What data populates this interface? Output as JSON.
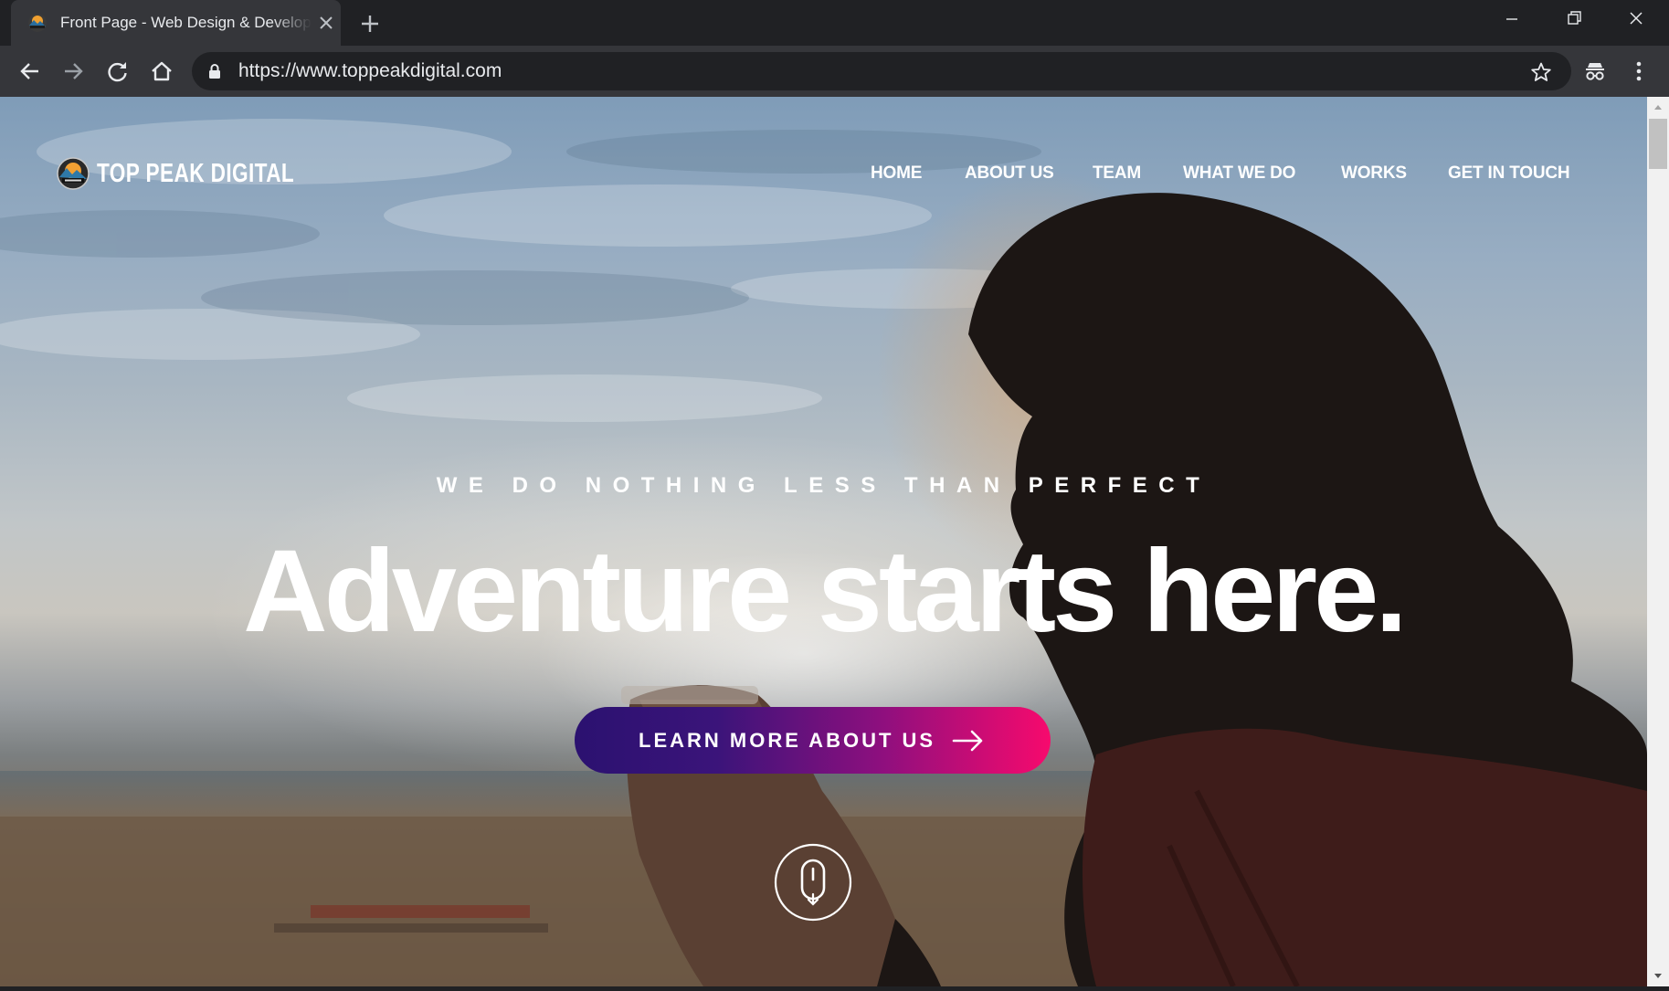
{
  "browser": {
    "tab_title": "Front Page - Web Design & Development",
    "url": "https://www.toppeakdigital.com"
  },
  "site": {
    "brand_name": "TOP PEAK DIGITAL",
    "nav": [
      "HOME",
      "ABOUT US",
      "TEAM",
      "WHAT WE DO",
      "WORKS",
      "GET IN TOUCH"
    ],
    "tagline": "WE DO NOTHING LESS THAN PERFECT",
    "headline": "Adventure starts here.",
    "cta_label": "LEARN MORE ABOUT US"
  },
  "colors": {
    "cta_gradient_start": "#2b1170",
    "cta_gradient_end": "#f70a6d",
    "chrome_dark": "#202124",
    "chrome_toolbar": "#35363a"
  },
  "icons": {
    "tab": [
      "site-favicon",
      "close-icon",
      "plus-icon"
    ],
    "window": [
      "minimize-icon",
      "restore-icon",
      "close-icon"
    ],
    "toolbar": [
      "back-arrow-icon",
      "forward-arrow-icon",
      "reload-icon",
      "home-icon",
      "lock-icon",
      "star-icon",
      "incognito-icon",
      "kebab-menu-icon"
    ],
    "page": [
      "brand-logo",
      "arrow-right-icon",
      "mouse-scroll-icon"
    ]
  }
}
